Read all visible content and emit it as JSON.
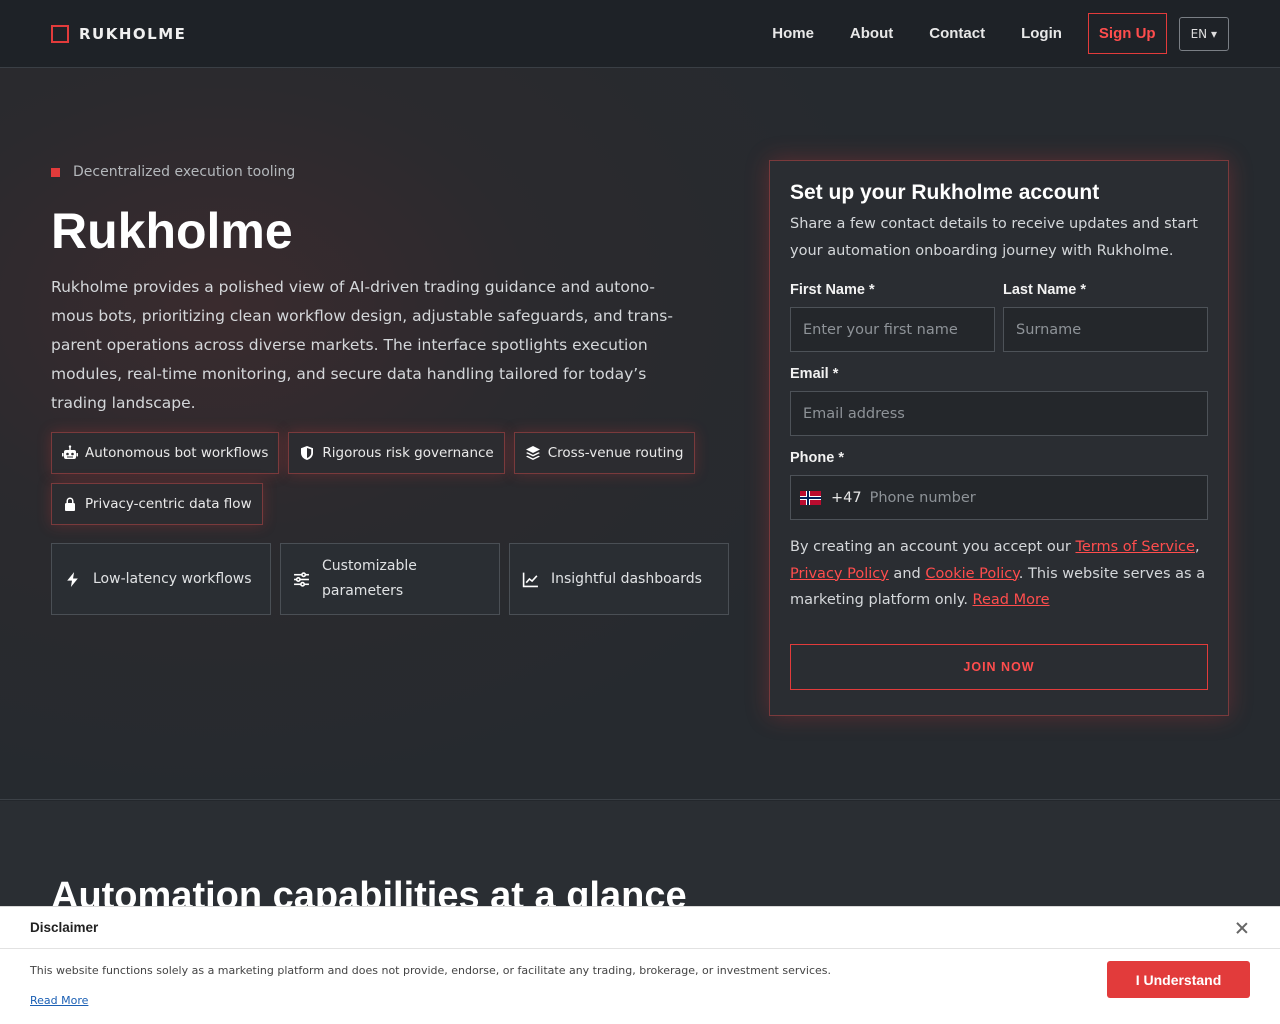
{
  "nav": {
    "brand": "RUKHOLME",
    "links": [
      "Home",
      "About",
      "Contact",
      "Login"
    ],
    "signup": "Sign Up",
    "language": "EN ▾"
  },
  "hero": {
    "tagline": "Decentralized execution tooling",
    "title": "Rukholme",
    "description": "Rukholme provides a polished view of AI-driven trading guidance and autono-mous bots, prioritizing clean workflow design, adjustable safeguards, and trans-parent operations across diverse markets. The interface spotlights execution modules, real-time monitoring, and secure data handling tailored for today’s trading landscape.",
    "chips": [
      {
        "label": "Autonomous bot workflows",
        "icon": "robot-icon"
      },
      {
        "label": "Rigorous risk governance",
        "icon": "shield-icon"
      },
      {
        "label": "Cross-venue routing",
        "icon": "layers-icon"
      },
      {
        "label": "Privacy-centric data flow",
        "icon": "lock-icon"
      }
    ],
    "features": [
      {
        "label": "Low-latency workflows",
        "icon": "bolt-icon"
      },
      {
        "label": "Customizable parameters",
        "icon": "sliders-icon"
      },
      {
        "label": "Insightful dashboards",
        "icon": "chart-line-icon"
      }
    ]
  },
  "form": {
    "title": "Set up your Rukholme account",
    "subtitle": "Share a few contact details to receive updates and start your automation onboarding journey with Rukholme.",
    "first_name_label": "First Name *",
    "first_name_placeholder": "Enter your first name",
    "last_name_label": "Last Name *",
    "last_name_placeholder": "Surname",
    "email_label": "Email *",
    "email_placeholder": "Email address",
    "phone_label": "Phone *",
    "phone_dial": "+47",
    "phone_placeholder": "Phone number",
    "terms_prefix": "By creating an account you accept our ",
    "terms_link": "Terms of Service",
    "terms_sep1": ",",
    "privacy_link": "Privacy Policy",
    "terms_and": " and ",
    "cookie_link": "Cookie Policy",
    "terms_suffix": ". This website serves as a marketing platform only. ",
    "read_more": "Read More",
    "submit": "JOIN NOW"
  },
  "section2": {
    "title": "Automation capabilities at a glance"
  },
  "disclaimer": {
    "title": "Disclaimer",
    "text": "This website functions solely as a marketing platform and does not provide, endorse, or facilitate any trading, brokerage, or investment services.",
    "read_more": "Read More",
    "button": "I Understand"
  },
  "colors": {
    "accent": "#e23b3b",
    "background": "#23272c"
  }
}
